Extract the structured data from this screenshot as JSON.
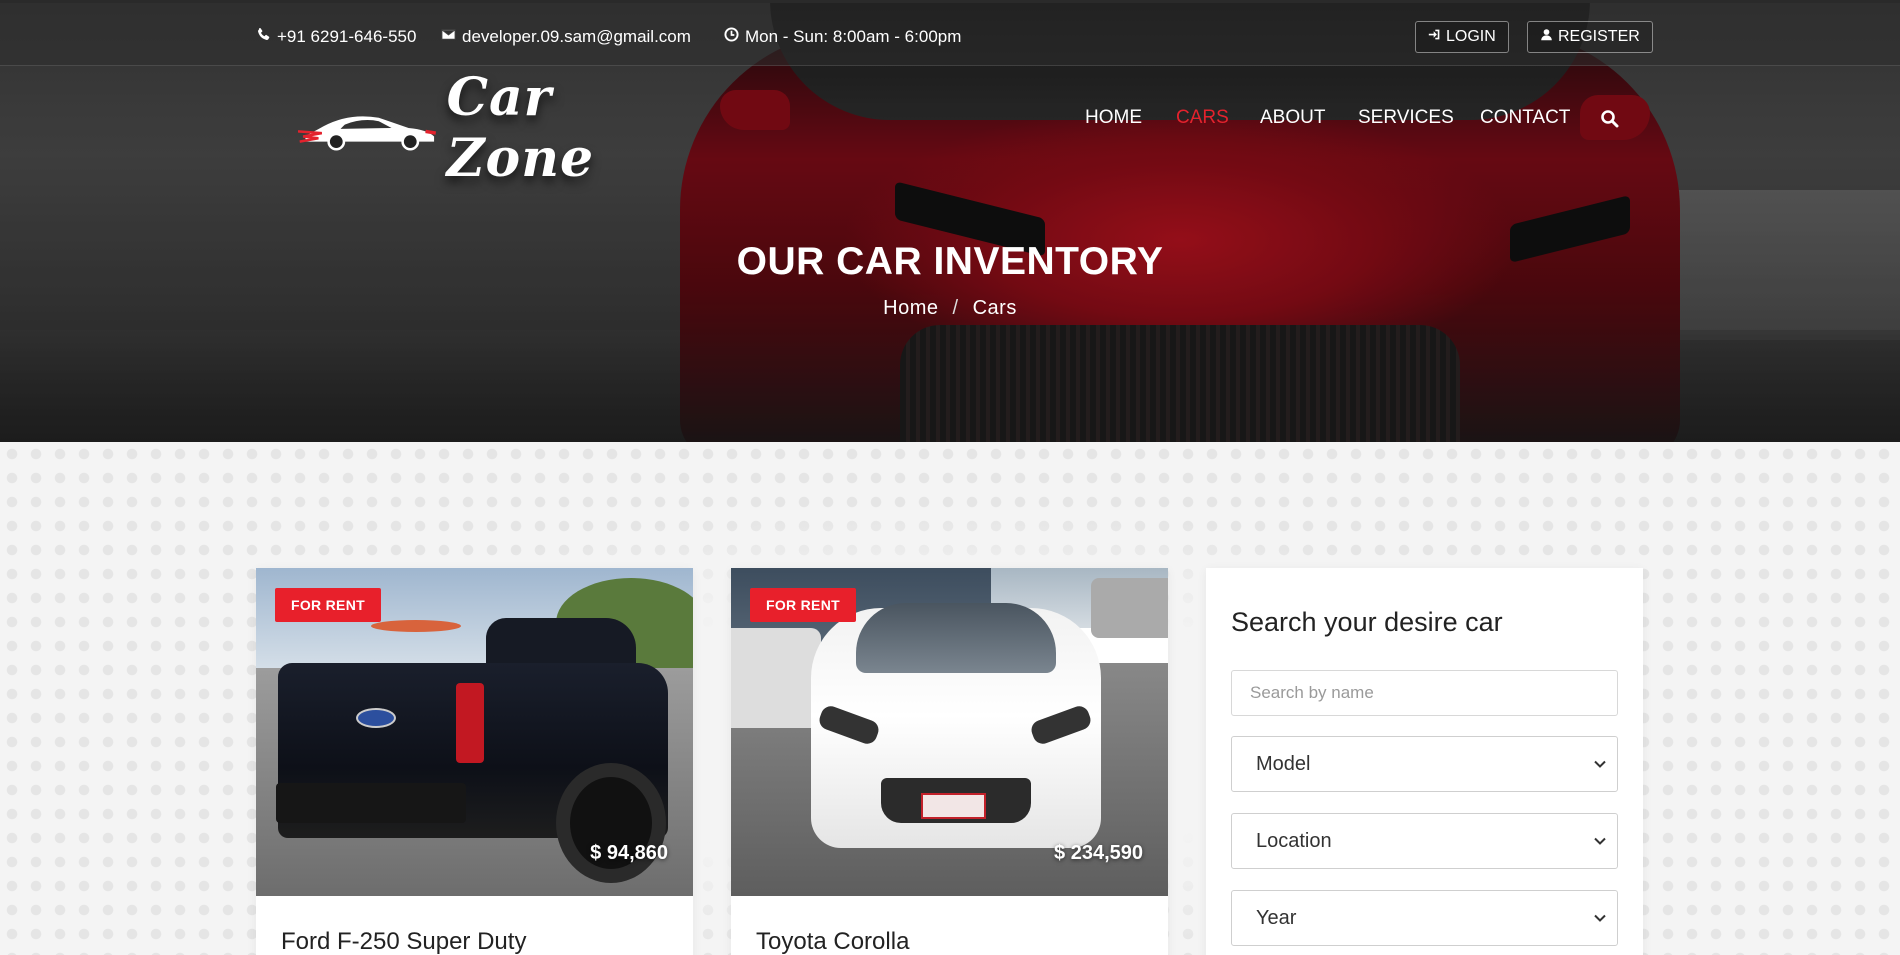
{
  "topbar": {
    "phone": "+91 6291-646-550",
    "email": "developer.09.sam@gmail.com",
    "hours": "Mon - Sun: 8:00am - 6:00pm",
    "login_label": "LOGIN",
    "register_label": "REGISTER"
  },
  "brand": {
    "name": "Car Zone"
  },
  "nav": {
    "items": [
      {
        "label": "HOME"
      },
      {
        "label": "CARS",
        "active": true
      },
      {
        "label": "ABOUT"
      },
      {
        "label": "SERVICES"
      },
      {
        "label": "CONTACT"
      }
    ]
  },
  "hero": {
    "title": "OUR CAR INVENTORY",
    "breadcrumb": [
      "Home",
      "Cars"
    ],
    "breadcrumb_separator": "/"
  },
  "cars": [
    {
      "badge": "FOR RENT",
      "price": "$ 94,860",
      "title": "Ford F-250 Super Duty"
    },
    {
      "badge": "FOR RENT",
      "price": "$ 234,590",
      "title": "Toyota Corolla"
    }
  ],
  "search": {
    "title": "Search your desire car",
    "name_placeholder": "Search by name",
    "model_label": "Model",
    "location_label": "Location",
    "year_label": "Year"
  },
  "colors": {
    "accent": "#e3222d",
    "badge": "#e8202b",
    "page_background": "#f4f4f4"
  }
}
